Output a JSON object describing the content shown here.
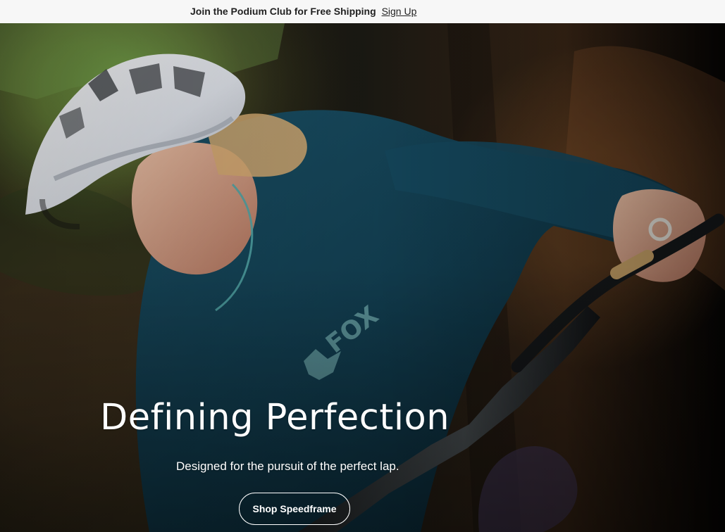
{
  "promo": {
    "message": "Join the Podium Club for Free Shipping",
    "link_label": "Sign Up"
  },
  "hero": {
    "title": "Defining Perfection",
    "subtitle": "Designed for the pursuit of the perfect lap.",
    "cta_label": "Shop Speedframe",
    "shirt_text": "FOX",
    "colors": {
      "promo_background": "#f7f7f7",
      "promo_text": "#222222",
      "headline_text": "#ffffff",
      "jersey": "#123f52",
      "helmet": "#e5e9f0",
      "bike_frame": "#1c1f21"
    }
  }
}
